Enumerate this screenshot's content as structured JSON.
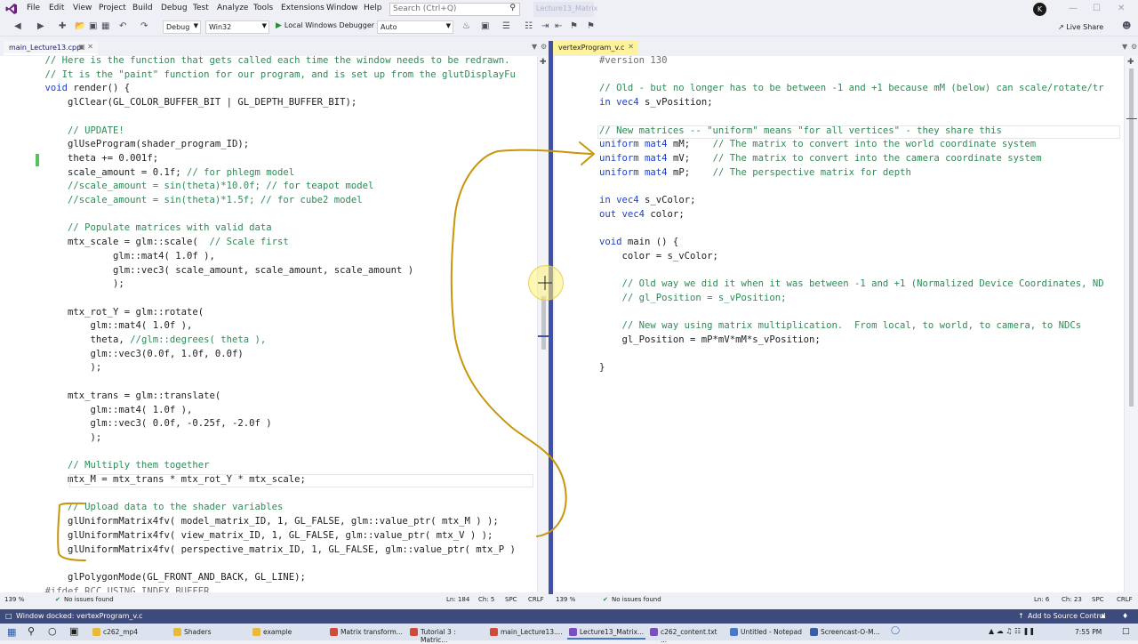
{
  "menu": {
    "items": [
      "File",
      "Edit",
      "View",
      "Project",
      "Build",
      "Debug",
      "Test",
      "Analyze",
      "Tools",
      "Extensions",
      "Window",
      "Help"
    ],
    "search_placeholder": "Search (Ctrl+Q)",
    "solution_name": "Lecture13_Matrix",
    "avatar_initial": "K"
  },
  "toolbar": {
    "config": "Debug",
    "platform": "Win32",
    "run_label": "Local Windows Debugger",
    "auto_label": "Auto",
    "live_share": "Live Share"
  },
  "left_pane": {
    "tab_title": "main_Lecture13.cpp",
    "lines": [
      {
        "segments": [
          {
            "t": "    // Here is the function that gets called each time the window needs to be redrawn.",
            "c": "comment"
          }
        ]
      },
      {
        "segments": [
          {
            "t": "    // It is the \"paint\" function for our program, and is set up from the glutDisplayFu",
            "c": "comment"
          }
        ]
      },
      {
        "segments": [
          {
            "t": "    ",
            "c": "plain"
          },
          {
            "t": "void",
            "c": "kw"
          },
          {
            "t": " render() {",
            "c": "plain"
          }
        ]
      },
      {
        "segments": [
          {
            "t": "        glClear(GL_COLOR_BUFFER_BIT | GL_DEPTH_BUFFER_BIT);",
            "c": "plain"
          }
        ]
      },
      {
        "segments": [
          {
            "t": "",
            "c": "plain"
          }
        ]
      },
      {
        "segments": [
          {
            "t": "        // UPDATE!",
            "c": "comment"
          }
        ]
      },
      {
        "segments": [
          {
            "t": "        glUseProgram(shader_program_ID);",
            "c": "plain"
          }
        ]
      },
      {
        "segments": [
          {
            "t": "        theta += 0.001f;",
            "c": "plain"
          }
        ]
      },
      {
        "segments": [
          {
            "t": "        scale_amount = 0.1f; ",
            "c": "plain"
          },
          {
            "t": "// for phlegm model",
            "c": "comment"
          }
        ]
      },
      {
        "segments": [
          {
            "t": "        //scale_amount = sin(theta)*10.0f; // for teapot model",
            "c": "comment"
          }
        ]
      },
      {
        "segments": [
          {
            "t": "        //scale_amount = sin(theta)*1.5f; // for cube2 model",
            "c": "comment"
          }
        ]
      },
      {
        "segments": [
          {
            "t": "",
            "c": "plain"
          }
        ]
      },
      {
        "segments": [
          {
            "t": "        // Populate matrices with valid data",
            "c": "comment"
          }
        ]
      },
      {
        "segments": [
          {
            "t": "        mtx_scale = glm::scale(  ",
            "c": "plain"
          },
          {
            "t": "// Scale first",
            "c": "comment"
          }
        ]
      },
      {
        "segments": [
          {
            "t": "                glm::mat4( 1.0f ),",
            "c": "plain"
          }
        ]
      },
      {
        "segments": [
          {
            "t": "                glm::vec3( scale_amount, scale_amount, scale_amount )",
            "c": "plain"
          }
        ]
      },
      {
        "segments": [
          {
            "t": "                );",
            "c": "plain"
          }
        ]
      },
      {
        "segments": [
          {
            "t": "",
            "c": "plain"
          }
        ]
      },
      {
        "segments": [
          {
            "t": "        mtx_rot_Y = glm::rotate(",
            "c": "plain"
          }
        ]
      },
      {
        "segments": [
          {
            "t": "            glm::mat4( 1.0f ),",
            "c": "plain"
          }
        ]
      },
      {
        "segments": [
          {
            "t": "            theta, ",
            "c": "plain"
          },
          {
            "t": "//glm::degrees( theta ),",
            "c": "comment"
          }
        ]
      },
      {
        "segments": [
          {
            "t": "            glm::vec3(0.0f, 1.0f, 0.0f)",
            "c": "plain"
          }
        ]
      },
      {
        "segments": [
          {
            "t": "            );",
            "c": "plain"
          }
        ]
      },
      {
        "segments": [
          {
            "t": "",
            "c": "plain"
          }
        ]
      },
      {
        "segments": [
          {
            "t": "        mtx_trans = glm::translate(",
            "c": "plain"
          }
        ]
      },
      {
        "segments": [
          {
            "t": "            glm::mat4( 1.0f ),",
            "c": "plain"
          }
        ]
      },
      {
        "segments": [
          {
            "t": "            glm::vec3( 0.0f, -0.25f, -2.0f )",
            "c": "plain"
          }
        ]
      },
      {
        "segments": [
          {
            "t": "            );",
            "c": "plain"
          }
        ]
      },
      {
        "segments": [
          {
            "t": "",
            "c": "plain"
          }
        ]
      },
      {
        "segments": [
          {
            "t": "        // Multiply them together",
            "c": "comment"
          }
        ]
      },
      {
        "segments": [
          {
            "t": "        mtx_M = mtx_trans * mtx_rot_Y * mtx_scale;",
            "c": "plain"
          }
        ]
      },
      {
        "segments": [
          {
            "t": "",
            "c": "plain"
          }
        ]
      },
      {
        "segments": [
          {
            "t": "        // Upload data to the shader variables",
            "c": "comment"
          }
        ]
      },
      {
        "segments": [
          {
            "t": "        glUniformMatrix4fv( model_matrix_ID, 1, GL_FALSE, glm::value_ptr( mtx_M ) );",
            "c": "plain"
          }
        ]
      },
      {
        "segments": [
          {
            "t": "        glUniformMatrix4fv( view_matrix_ID, 1, GL_FALSE, glm::value_ptr( mtx_V ) );",
            "c": "plain"
          }
        ]
      },
      {
        "segments": [
          {
            "t": "        glUniformMatrix4fv( perspective_matrix_ID, 1, GL_FALSE, glm::value_ptr( mtx_P )",
            "c": "plain"
          }
        ]
      },
      {
        "segments": [
          {
            "t": "",
            "c": "plain"
          }
        ]
      },
      {
        "segments": [
          {
            "t": "        glPolygonMode(GL_FRONT_AND_BACK, GL_LINE);",
            "c": "plain"
          }
        ]
      },
      {
        "segments": [
          {
            "t": "    #ifdef RCC_USING_INDEX_BUFFER",
            "c": "pre"
          }
        ]
      }
    ],
    "status": {
      "zoom": "139 %",
      "issues": "No issues found",
      "ln": "Ln: 184",
      "ch": "Ch: 5",
      "spc": "SPC",
      "crlf": "CRLF"
    }
  },
  "right_pane": {
    "tab_title": "vertexProgram_v.c",
    "lines": [
      {
        "segments": [
          {
            "t": "#version 130",
            "c": "pre"
          }
        ]
      },
      {
        "segments": [
          {
            "t": "",
            "c": "plain"
          }
        ]
      },
      {
        "segments": [
          {
            "t": "// Old - but no longer has to be between -1 and +1 because mM (below) can scale/rotate/tr",
            "c": "comment"
          }
        ]
      },
      {
        "segments": [
          {
            "t": "in",
            "c": "kw"
          },
          {
            "t": " ",
            "c": "plain"
          },
          {
            "t": "vec4",
            "c": "kw"
          },
          {
            "t": " s_vPosition;",
            "c": "plain"
          }
        ]
      },
      {
        "segments": [
          {
            "t": "",
            "c": "plain"
          }
        ]
      },
      {
        "segments": [
          {
            "t": "// New matrices -- \"uniform\" means \"for all vertices\" - they share this",
            "c": "comment"
          }
        ]
      },
      {
        "segments": [
          {
            "t": "uniform",
            "c": "kw"
          },
          {
            "t": " ",
            "c": "plain"
          },
          {
            "t": "mat4",
            "c": "kw"
          },
          {
            "t": " mM;    ",
            "c": "plain"
          },
          {
            "t": "// The matrix to convert into the world coordinate system",
            "c": "comment"
          }
        ]
      },
      {
        "segments": [
          {
            "t": "uniform",
            "c": "kw"
          },
          {
            "t": " ",
            "c": "plain"
          },
          {
            "t": "mat4",
            "c": "kw"
          },
          {
            "t": " mV;    ",
            "c": "plain"
          },
          {
            "t": "// The matrix to convert into the camera coordinate system",
            "c": "comment"
          }
        ]
      },
      {
        "segments": [
          {
            "t": "uniform",
            "c": "kw"
          },
          {
            "t": " ",
            "c": "plain"
          },
          {
            "t": "mat4",
            "c": "kw"
          },
          {
            "t": " mP;    ",
            "c": "plain"
          },
          {
            "t": "// The perspective matrix for depth",
            "c": "comment"
          }
        ]
      },
      {
        "segments": [
          {
            "t": "",
            "c": "plain"
          }
        ]
      },
      {
        "segments": [
          {
            "t": "in",
            "c": "kw"
          },
          {
            "t": " ",
            "c": "plain"
          },
          {
            "t": "vec4",
            "c": "kw"
          },
          {
            "t": " s_vColor;",
            "c": "plain"
          }
        ]
      },
      {
        "segments": [
          {
            "t": "out",
            "c": "kw"
          },
          {
            "t": " ",
            "c": "plain"
          },
          {
            "t": "vec4",
            "c": "kw"
          },
          {
            "t": " color;",
            "c": "plain"
          }
        ]
      },
      {
        "segments": [
          {
            "t": "",
            "c": "plain"
          }
        ]
      },
      {
        "segments": [
          {
            "t": "void",
            "c": "kw"
          },
          {
            "t": " main () {",
            "c": "plain"
          }
        ]
      },
      {
        "segments": [
          {
            "t": "    color = s_vColor;",
            "c": "plain"
          }
        ]
      },
      {
        "segments": [
          {
            "t": "",
            "c": "plain"
          }
        ]
      },
      {
        "segments": [
          {
            "t": "    // Old way we did it when it was between -1 and +1 (Normalized Device Coordinates, ND",
            "c": "comment"
          }
        ]
      },
      {
        "segments": [
          {
            "t": "    // gl_Position = s_vPosition;",
            "c": "comment"
          }
        ]
      },
      {
        "segments": [
          {
            "t": "",
            "c": "plain"
          }
        ]
      },
      {
        "segments": [
          {
            "t": "    // New way using matrix multiplication.  From local, to world, to camera, to NDCs",
            "c": "comment"
          }
        ]
      },
      {
        "segments": [
          {
            "t": "    gl_Position = mP*mV*mM*s_vPosition;",
            "c": "plain"
          }
        ]
      },
      {
        "segments": [
          {
            "t": "",
            "c": "plain"
          }
        ]
      },
      {
        "segments": [
          {
            "t": "}",
            "c": "plain"
          }
        ]
      }
    ],
    "status": {
      "zoom": "139 %",
      "issues": "No issues found",
      "ln": "Ln: 6",
      "ch": "Ch: 23",
      "spc": "SPC",
      "crlf": "CRLF"
    }
  },
  "statusbar": {
    "message": "Window docked: vertexProgram_v.c",
    "source_control": "Add to Source Control"
  },
  "taskbar": {
    "items": [
      {
        "label": "c262_mp4",
        "color": "#e8b93a"
      },
      {
        "label": "Shaders",
        "color": "#e8b93a"
      },
      {
        "label": "example",
        "color": "#e8b93a"
      },
      {
        "label": "Matrix transform...",
        "color": "#d04a3a"
      },
      {
        "label": "Tutorial 3 : Matric...",
        "color": "#d04a3a"
      },
      {
        "label": "main_Lecture13....",
        "color": "#d04a3a"
      },
      {
        "label": "Lecture13_Matrix...",
        "color": "#7b4fc0"
      },
      {
        "label": "c262_content.txt ...",
        "color": "#7b4fc0"
      },
      {
        "label": "Untitled - Notepad",
        "color": "#4a78c8"
      },
      {
        "label": "Screencast-O-M...",
        "color": "#3a5fa8"
      }
    ],
    "clock": "7:55 PM"
  },
  "colors": {
    "comment": "#2e8b57",
    "keyword": "#2040c8",
    "splitter": "#3f51a8",
    "statusbar": "#3c4a7c",
    "annotation": "#c8960a"
  }
}
